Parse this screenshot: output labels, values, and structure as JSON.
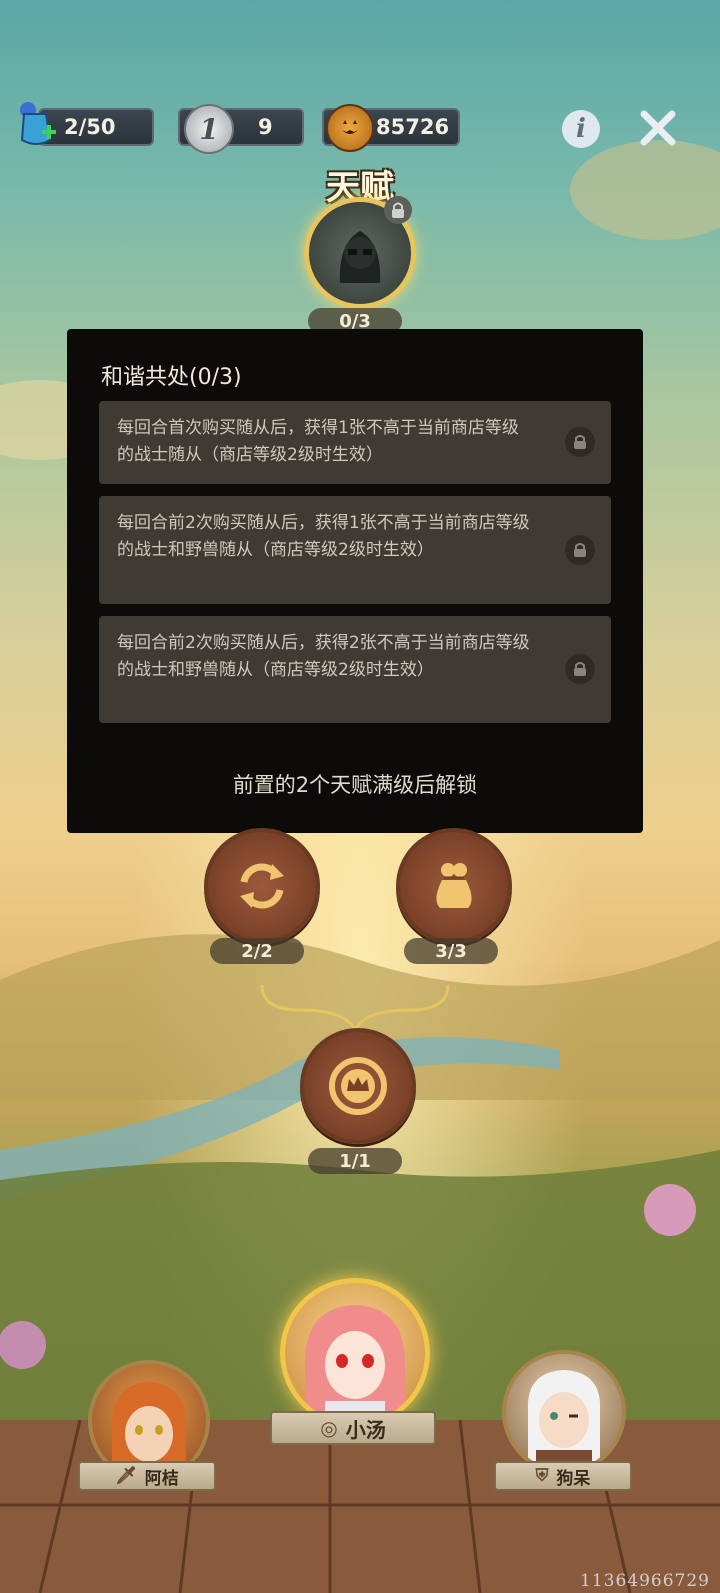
{
  "top_bar": {
    "energy": "2/50",
    "silver": "9",
    "silver_icon_text": "1",
    "gold": "85726"
  },
  "talent": {
    "title": "天赋",
    "progress": "0/3"
  },
  "popup": {
    "title": "和谐共处(0/3)",
    "options": [
      {
        "text": "每回合首次购买随从后，获得1张不高于当前商店等级的战士随从（商店等级2级时生效）"
      },
      {
        "text": "每回合前2次购买随从后，获得1张不高于当前商店等级的战士和野兽随从（商店等级2级时生效）"
      },
      {
        "text": "每回合前2次购买随从后，获得2张不高于当前商店等级的战士和野兽随从（商店等级2级时生效）"
      }
    ],
    "unlock_hint": "前置的2个天赋满级后解锁"
  },
  "nodes": {
    "refresh_progress": "2/2",
    "bag_progress": "3/3",
    "crown_progress": "1/1"
  },
  "characters": {
    "left_name": "阿桔",
    "center_name": "小汤",
    "right_name": "狗呆"
  },
  "footer_id": "11364966729",
  "colors": {
    "gold_border": "#e6c45e",
    "wood": "#7a4128",
    "popup_bg": "#0c0b0a",
    "option_bg": "#3f3b34"
  }
}
